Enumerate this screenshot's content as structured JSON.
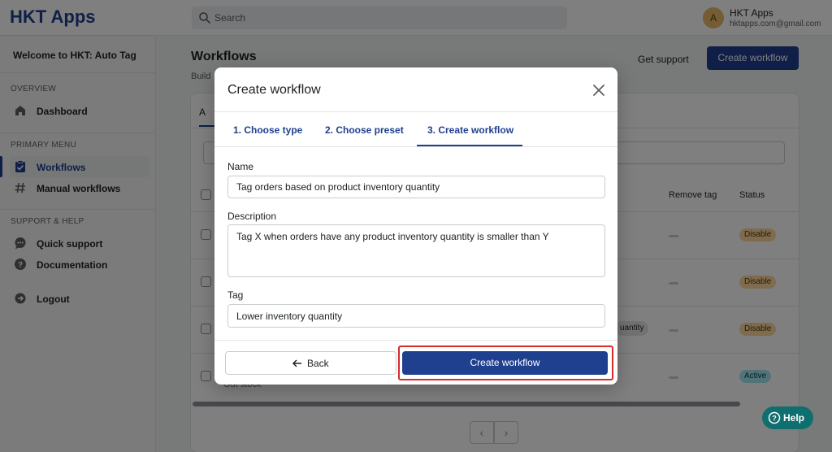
{
  "app": {
    "logo": "HKT Apps"
  },
  "search": {
    "placeholder": "Search"
  },
  "user": {
    "initial": "A",
    "name": "HKT Apps",
    "email": "hktapps.com@gmail.com"
  },
  "sidebar": {
    "welcome": "Welcome to HKT: Auto Tag",
    "sections": [
      {
        "heading": "OVERVIEW"
      },
      {
        "heading": "PRIMARY MENU"
      },
      {
        "heading": "SUPPORT & HELP"
      }
    ],
    "items": [
      {
        "label": "Dashboard",
        "icon": "home-icon"
      },
      {
        "label": "Workflows",
        "icon": "clipboard-check-icon",
        "active": true
      },
      {
        "label": "Manual workflows",
        "icon": "hashtag-icon"
      },
      {
        "label": "Quick support",
        "icon": "chat-icon"
      },
      {
        "label": "Documentation",
        "icon": "question-circle-icon"
      },
      {
        "label": "Logout",
        "icon": "logout-icon"
      }
    ]
  },
  "page": {
    "title": "Workflows",
    "subtitle": "Build",
    "get_support": "Get support",
    "create_button": "Create workflow"
  },
  "table": {
    "tab_label": "A",
    "headers": [
      "Remove tag",
      "Status"
    ],
    "rows": [
      {
        "status": "Disable"
      },
      {
        "status": "Disable"
      },
      {
        "status": "Disable",
        "chip": "uantity"
      },
      {
        "status": "Active",
        "note": "Out stock"
      }
    ],
    "pagination": {
      "prev": "‹",
      "next": "›"
    }
  },
  "help": {
    "label": "Help"
  },
  "modal": {
    "title": "Create workflow",
    "steps": [
      "1. Choose type",
      "2. Choose preset",
      "3. Create workflow"
    ],
    "active_step": 3,
    "fields": {
      "name": {
        "label": "Name",
        "value": "Tag orders based on product inventory quantity"
      },
      "description": {
        "label": "Description",
        "value": "Tag X when orders have any product inventory quantity is smaller than Y"
      },
      "tag": {
        "label": "Tag",
        "value": "Lower inventory quantity"
      }
    },
    "back_label": "Back",
    "create_label": "Create workflow"
  },
  "colors": {
    "brand": "#1f3f8f",
    "highlight": "#d72c2c",
    "help": "#0f6e6e"
  }
}
